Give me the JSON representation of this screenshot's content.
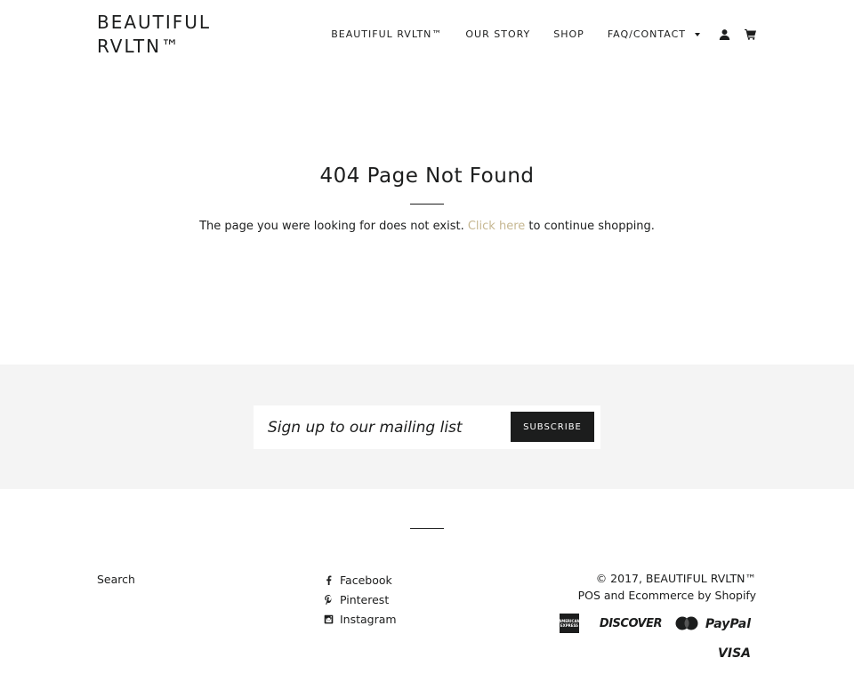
{
  "header": {
    "logo": "BEAUTIFUL RVLTN™",
    "nav": [
      {
        "label": "BEAUTIFUL RVLTN™"
      },
      {
        "label": "OUR STORY"
      },
      {
        "label": "SHOP"
      },
      {
        "label": "FAQ/CONTACT"
      }
    ],
    "icons": {
      "account": "user-icon",
      "cart": "cart-icon",
      "dropdown": "caret-down-icon"
    }
  },
  "main": {
    "title": "404 Page Not Found",
    "message_before": "The page you were looking for does not exist. ",
    "link_text": "Click here",
    "message_after": " to continue shopping."
  },
  "newsletter": {
    "placeholder": "Sign up to our mailing list",
    "button_label": "SUBSCRIBE"
  },
  "footer": {
    "links": [
      {
        "label": "Search"
      }
    ],
    "social": [
      {
        "label": "Facebook",
        "icon": "facebook-icon"
      },
      {
        "label": "Pinterest",
        "icon": "pinterest-icon"
      },
      {
        "label": "Instagram",
        "icon": "instagram-icon"
      }
    ],
    "copyright": "© 2017, BEAUTIFUL RVLTN™",
    "pos_text": "POS and Ecommerce by Shopify",
    "payments": {
      "discover": "DISCOVER",
      "paypal": "PayPal",
      "visa": "VISA"
    }
  },
  "colors": {
    "text": "#1c1d1d",
    "accent_link": "#c6b791",
    "newsletter_bg": "#f4f4f4",
    "button_bg": "#1c1d1d"
  }
}
